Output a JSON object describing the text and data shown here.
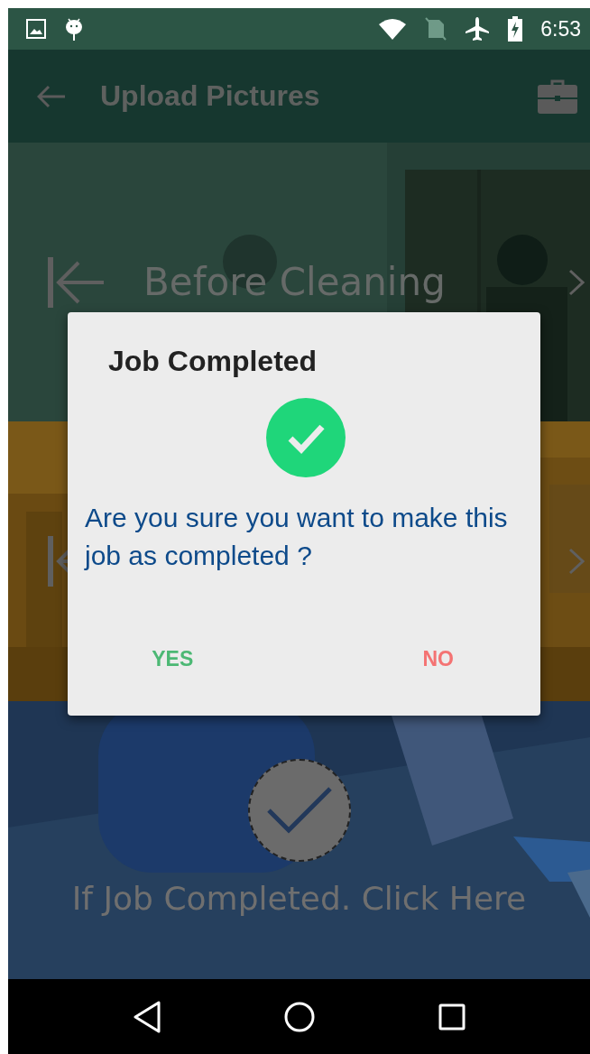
{
  "status_bar": {
    "time": "6:53"
  },
  "app_bar": {
    "title": "Upload Pictures"
  },
  "panels": [
    {
      "kind": "labeled",
      "label": "Before Cleaning"
    },
    {
      "kind": "covered"
    }
  ],
  "complete_action": {
    "label": "If Job Completed. Click Here"
  },
  "dialog": {
    "title": "Job Completed",
    "message": "Are you sure you want to make this job as completed ?",
    "buttons": [
      {
        "kind": "confirm",
        "label": "YES"
      },
      {
        "kind": "cancel",
        "label": "NO"
      }
    ]
  }
}
